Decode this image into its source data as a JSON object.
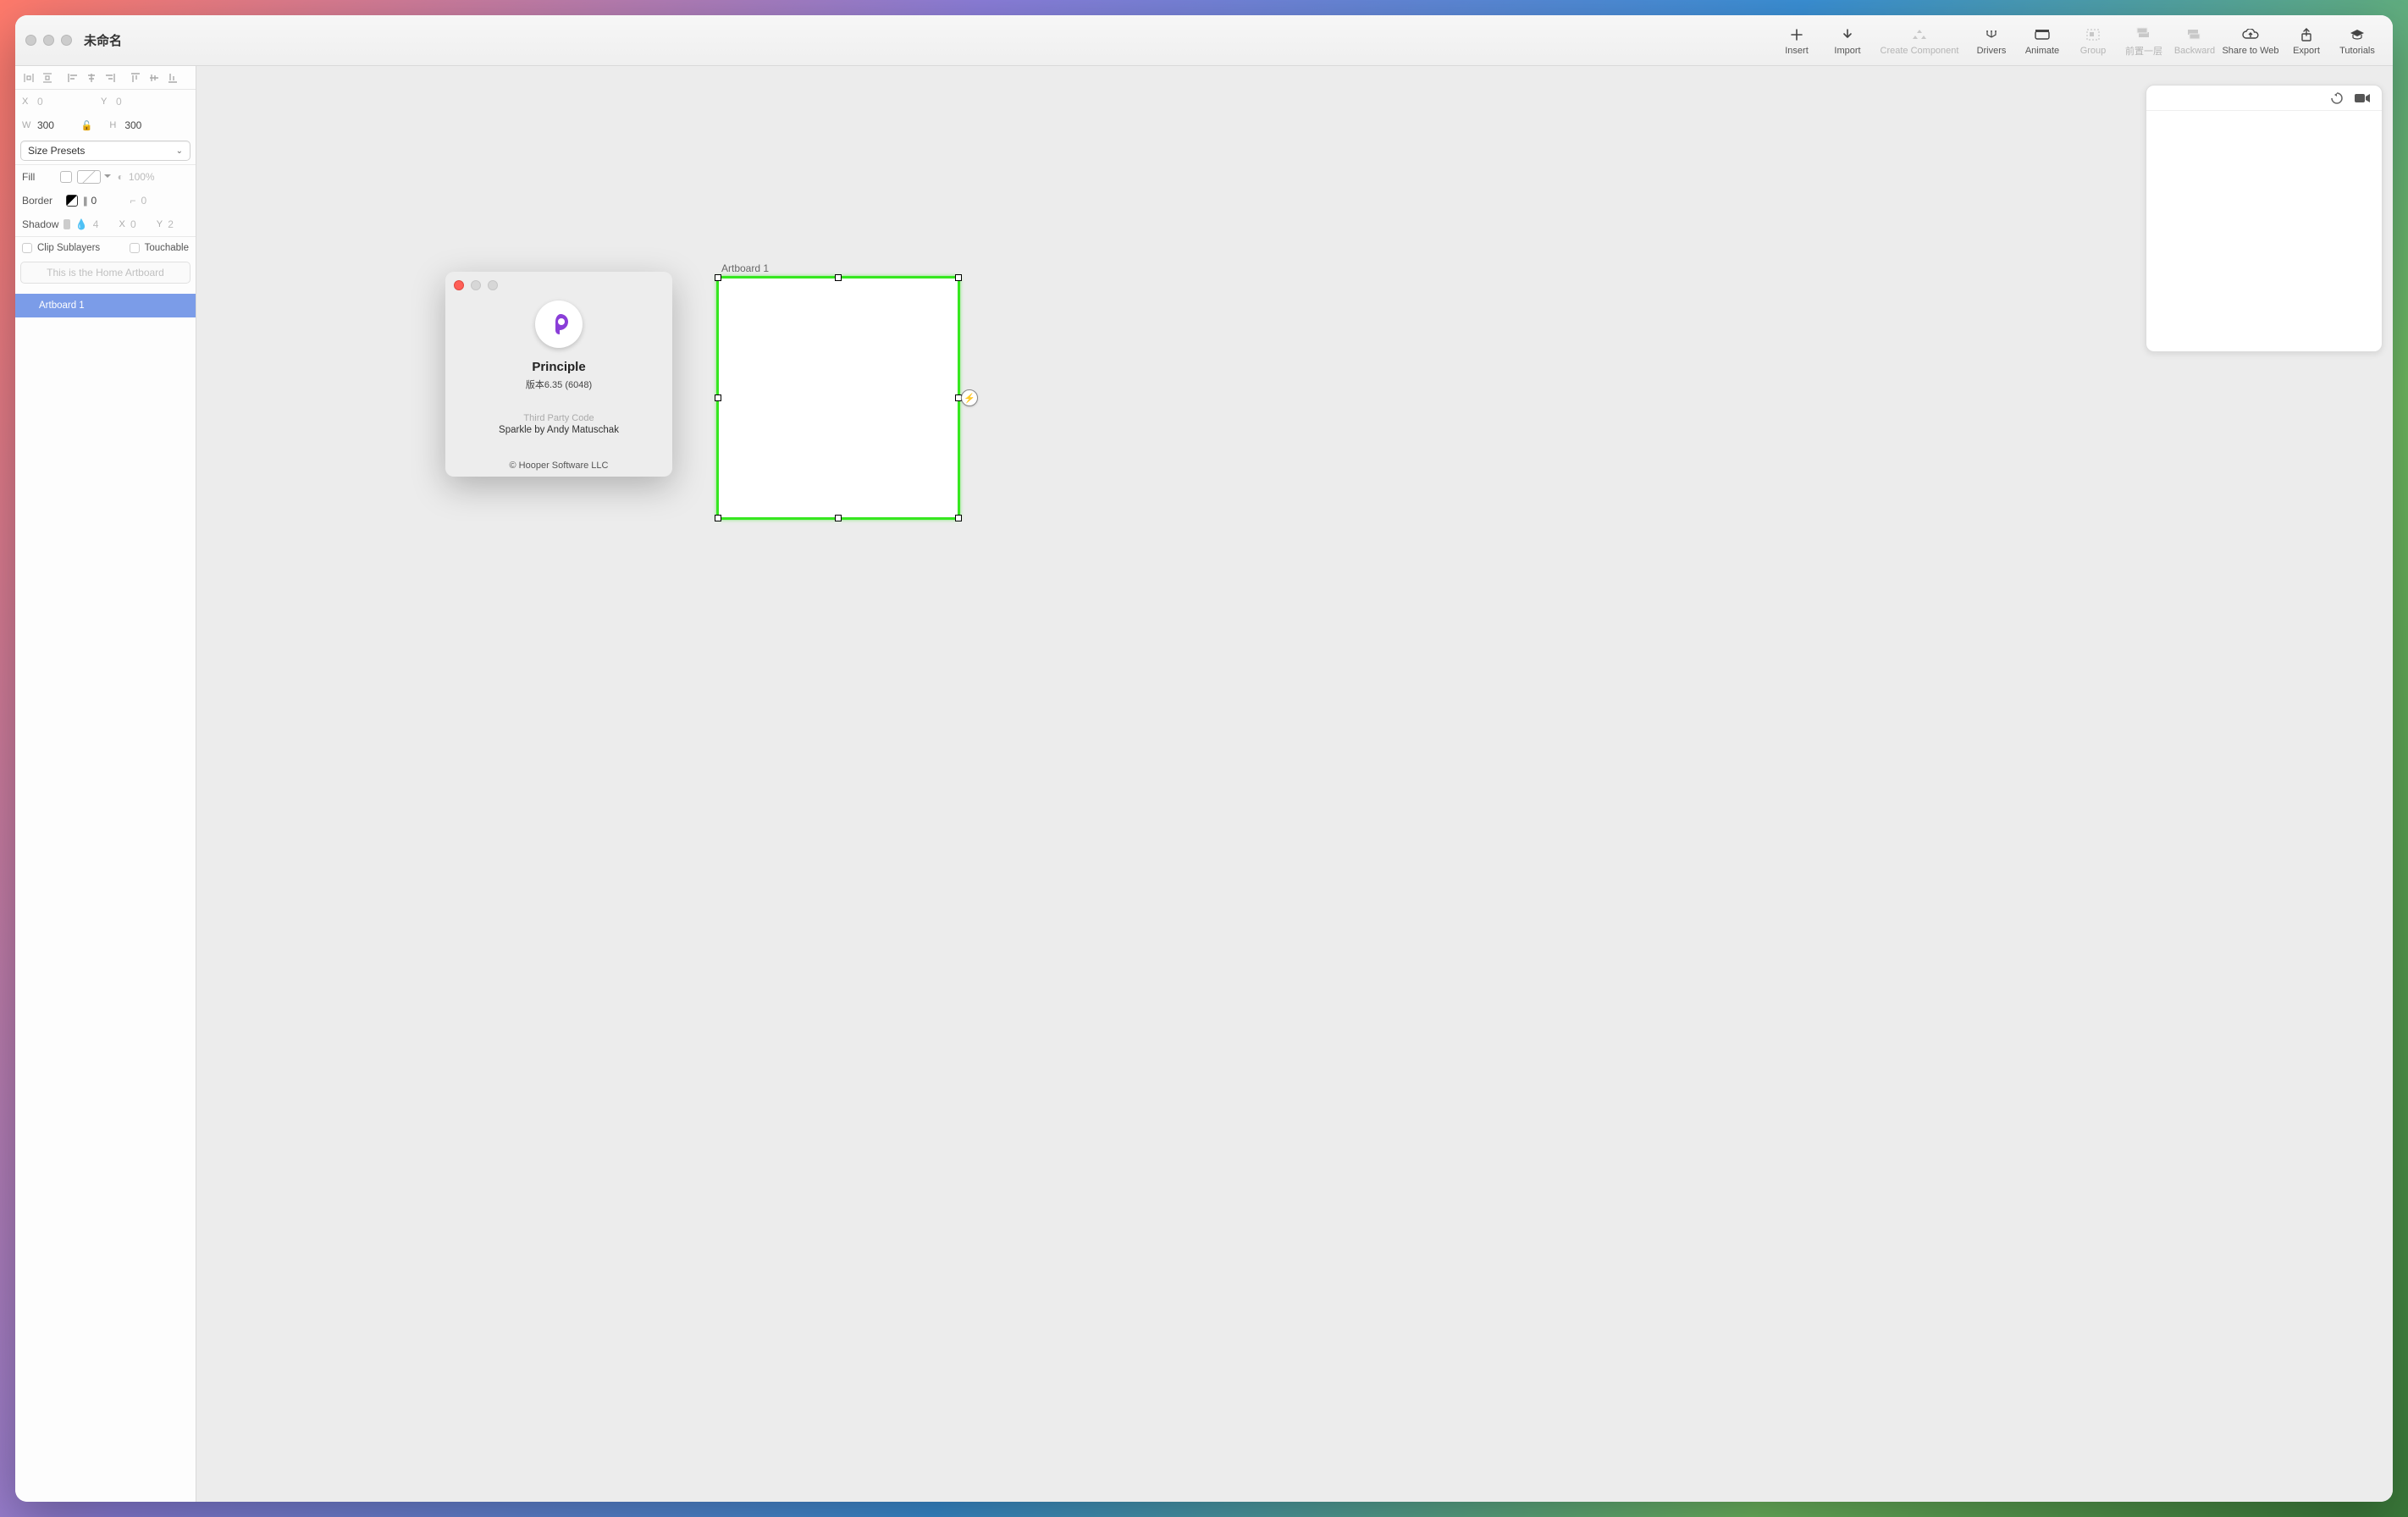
{
  "window": {
    "title": "未命名"
  },
  "toolbar": {
    "insert": "Insert",
    "import": "Import",
    "create_component": "Create Component",
    "drivers": "Drivers",
    "animate": "Animate",
    "group": "Group",
    "forward": "前置一层",
    "backward": "Backward",
    "share_to_web": "Share to Web",
    "export": "Export",
    "tutorials": "Tutorials"
  },
  "inspector": {
    "x_label": "X",
    "x_value": "0",
    "y_label": "Y",
    "y_value": "0",
    "w_label": "W",
    "w_value": "300",
    "h_label": "H",
    "h_value": "300",
    "size_presets": "Size Presets",
    "fill_label": "Fill",
    "fill_opacity": "100%",
    "border_label": "Border",
    "border_width": "0",
    "corner_radius": "0",
    "shadow_label": "Shadow",
    "shadow_blur": "4",
    "shadow_x_label": "X",
    "shadow_x": "0",
    "shadow_y_label": "Y",
    "shadow_y": "2",
    "clip_sublayers": "Clip Sublayers",
    "touchable": "Touchable",
    "home_artboard_placeholder": "This is the Home Artboard"
  },
  "layers": {
    "items": [
      {
        "name": "Artboard 1"
      }
    ]
  },
  "canvas": {
    "artboard_label": "Artboard 1"
  },
  "about": {
    "app_name": "Principle",
    "version": "版本6.35 (6048)",
    "third_party": "Third Party Code",
    "sparkle": "Sparkle by Andy Matuschak",
    "copyright": "© Hooper Software LLC"
  }
}
